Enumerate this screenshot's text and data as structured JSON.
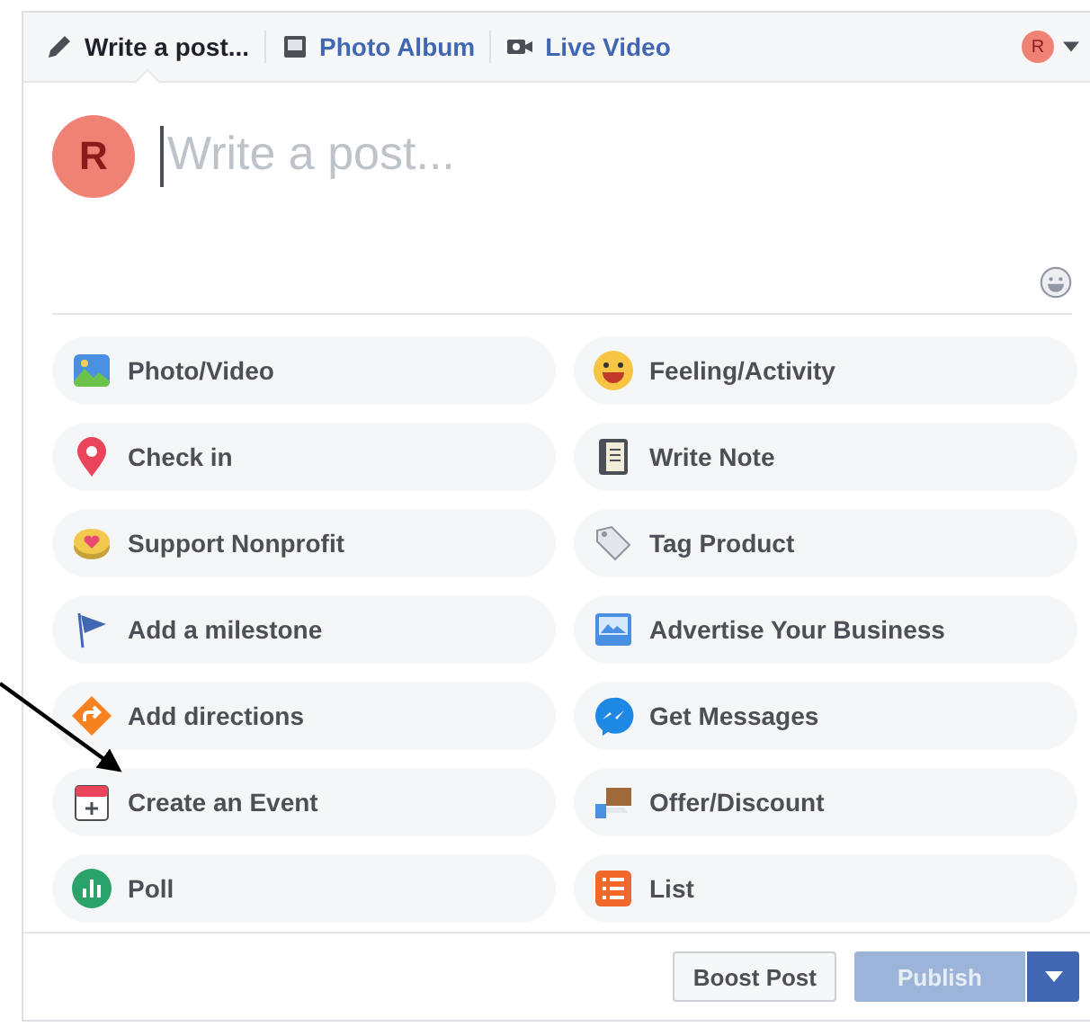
{
  "tabs": [
    {
      "label": "Write a post...",
      "selected": true
    },
    {
      "label": "Photo Album",
      "selected": false
    },
    {
      "label": "Live Video",
      "selected": false
    }
  ],
  "account": {
    "initial": "R"
  },
  "composer": {
    "avatar_initial": "R",
    "placeholder": "Write a post..."
  },
  "options": [
    {
      "label": "Photo/Video"
    },
    {
      "label": "Feeling/Activity"
    },
    {
      "label": "Check in"
    },
    {
      "label": "Write Note"
    },
    {
      "label": "Support Nonprofit"
    },
    {
      "label": "Tag Product"
    },
    {
      "label": "Add a milestone"
    },
    {
      "label": "Advertise Your Business"
    },
    {
      "label": "Add directions"
    },
    {
      "label": "Get Messages"
    },
    {
      "label": "Create an Event"
    },
    {
      "label": "Offer/Discount"
    },
    {
      "label": "Poll"
    },
    {
      "label": "List"
    }
  ],
  "footer": {
    "boost_label": "Boost Post",
    "publish_label": "Publish",
    "publish_disabled": true
  }
}
